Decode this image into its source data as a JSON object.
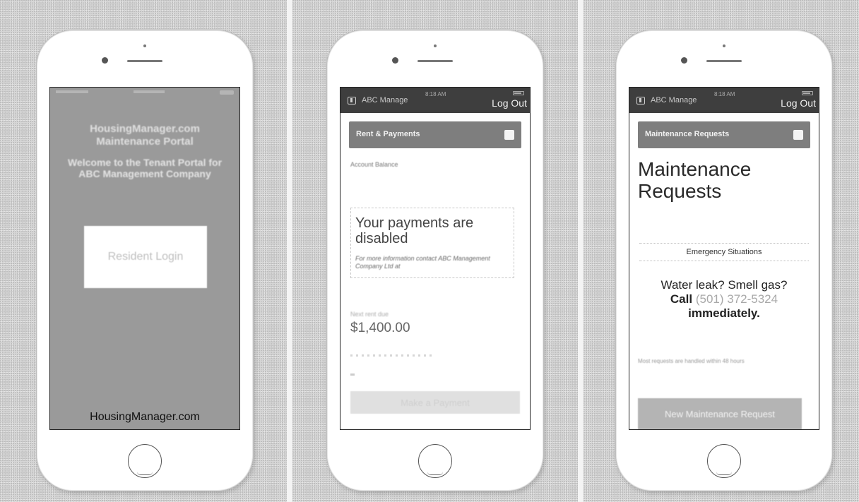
{
  "screens": [
    {
      "title": "HousingManager.com Maintenance Portal",
      "subtitle": "Welcome to the Tenant Portal for ABC Management Company",
      "login_label": "Resident Login",
      "footer": "HousingManager.com"
    },
    {
      "app_name": "ABC Manage",
      "clock": "8:18 AM",
      "logout_label": "Log Out",
      "section_title": "Rent & Payments",
      "balance_label": "Account Balance",
      "notice_heading": "Your payments are disabled",
      "notice_body": "For more information contact ABC Management Company Ltd at",
      "rent_label": "Next rent due",
      "rent_amount": "$1,400.00",
      "pay_button": "Make a Payment"
    },
    {
      "app_name": "ABC Manage",
      "clock": "8:18 AM",
      "logout_label": "Log Out",
      "section_title": "Maintenance Requests",
      "page_heading": "Maintenance Requests",
      "emergency_label": "Emergency Situations",
      "callout_question": "Water leak? Smell gas?",
      "callout_call": "Call",
      "callout_phone": "(501) 372-5324",
      "callout_immediately": "immediately.",
      "note": "Most requests are handled within 48 hours",
      "new_request_button": "New Maintenance Request"
    }
  ]
}
